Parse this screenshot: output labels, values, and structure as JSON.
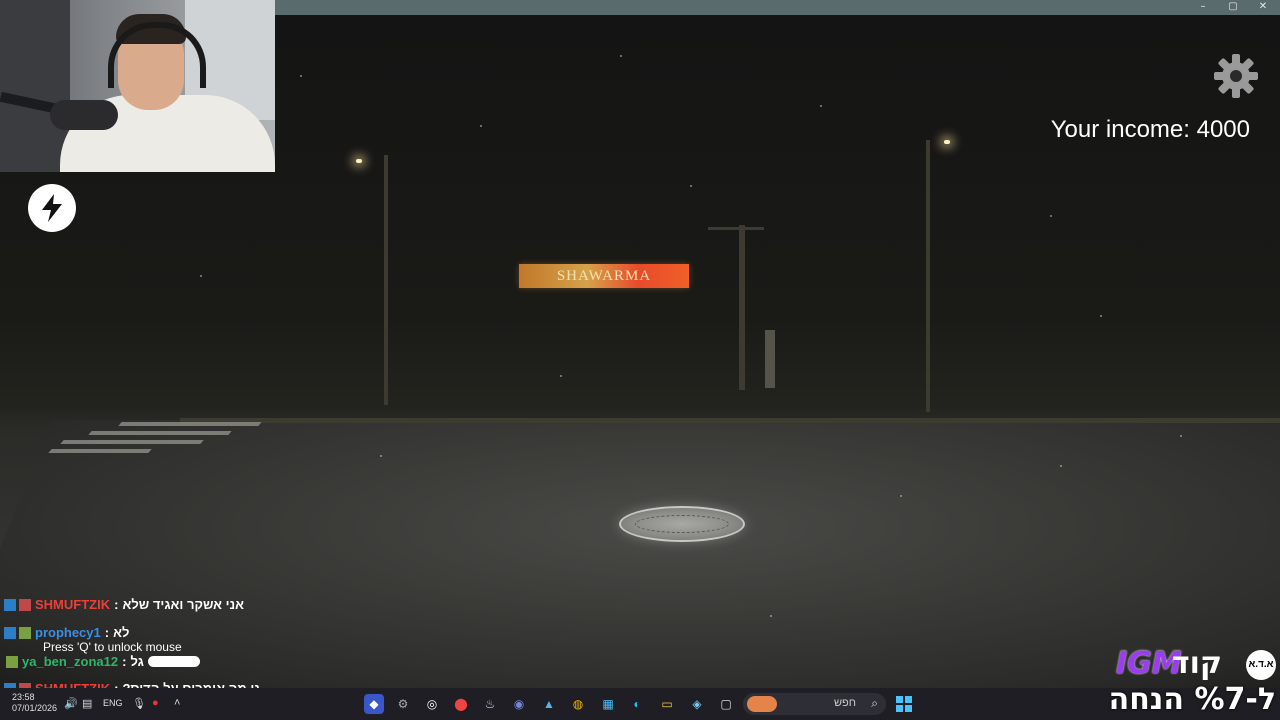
{
  "window": {
    "controls": [
      "–",
      "▢",
      "✕"
    ]
  },
  "hud": {
    "income_text": "Your income: 4000",
    "settings_icon": "gear-icon",
    "bolt_icon": "lightning-bolt-icon",
    "hint": "Press 'Q' to unlock mouse"
  },
  "scene": {
    "sign_text": "SHAWARMA"
  },
  "chat": {
    "messages": [
      {
        "user": "SHMUFTZIK",
        "text": "אני אשקר ואגיד שלא",
        "color": "#e8413c"
      },
      {
        "user": "prophecy1",
        "text": "לא",
        "color": "#3b8ee6"
      },
      {
        "user": "ya_ben_zona12",
        "text": "גל",
        "color": "#2fb56a"
      },
      {
        "user": "SHMUFTZIK",
        "text": "?נו מה אומרים על הדיס",
        "color": "#e8413c"
      }
    ]
  },
  "promo": {
    "code_word": "קוד",
    "brand": "IGM",
    "logo": "א.ד.א",
    "line2": "ל-%7 הנחה"
  },
  "taskbar": {
    "time": "23:58",
    "date": "07/01/2026",
    "lang": "ENG",
    "search_placeholder": "חפש"
  }
}
